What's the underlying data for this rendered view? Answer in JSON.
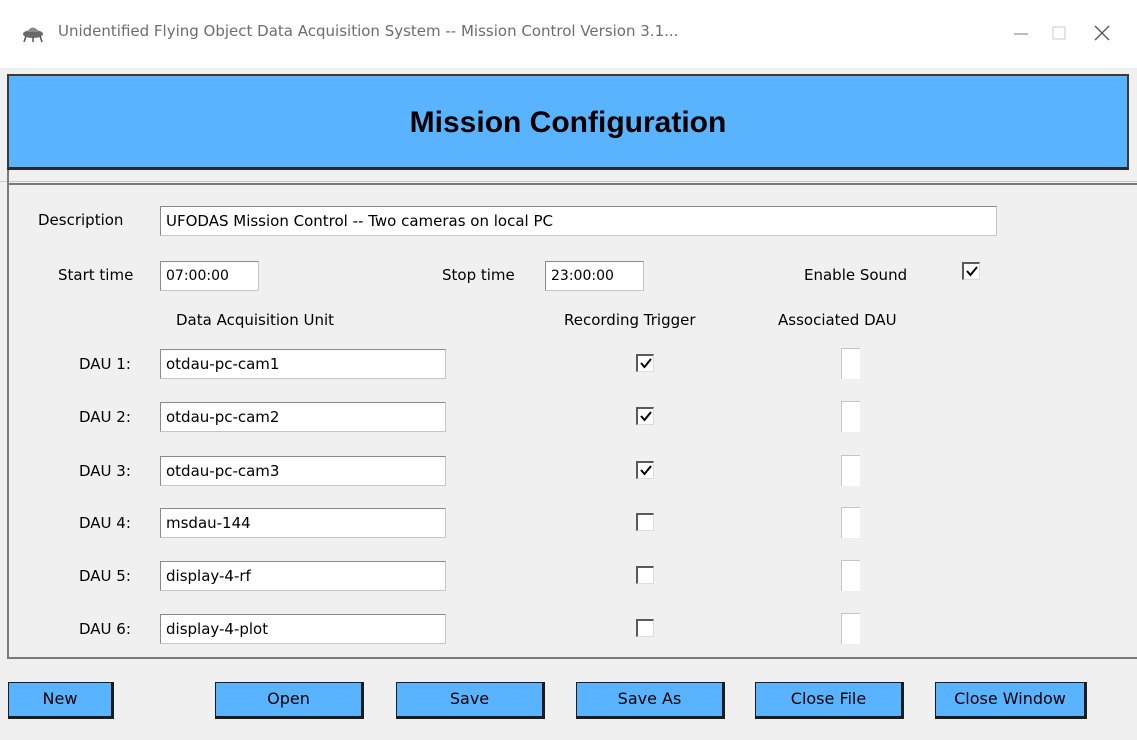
{
  "window": {
    "title": "Unidentified Flying Object Data Acquisition System -- Mission Control   Version 3.1...",
    "minimize_icon": "minimize-icon",
    "maximize_icon": "maximize-icon",
    "close_icon": "close-icon"
  },
  "banner": {
    "title": "Mission Configuration",
    "color": "#5ab3ff"
  },
  "form": {
    "description_label": "Description",
    "description_value": "UFODAS Mission Control -- Two cameras on local PC",
    "start_time_label": "Start time",
    "start_time_value": "07:00:00",
    "stop_time_label": "Stop time",
    "stop_time_value": "23:00:00",
    "enable_sound_label": "Enable Sound",
    "enable_sound_checked": true
  },
  "columns": {
    "dau": "Data Acquisition Unit",
    "trigger": "Recording Trigger",
    "associated": "Associated DAU"
  },
  "daus": [
    {
      "label": "DAU 1:",
      "value": "otdau-pc-cam1",
      "trigger": true,
      "associated": false
    },
    {
      "label": "DAU 2:",
      "value": "otdau-pc-cam2",
      "trigger": true,
      "associated": false
    },
    {
      "label": "DAU 3:",
      "value": "otdau-pc-cam3",
      "trigger": true,
      "associated": false
    },
    {
      "label": "DAU 4:",
      "value": "msdau-144",
      "trigger": false,
      "associated": false
    },
    {
      "label": "DAU 5:",
      "value": "display-4-rf",
      "trigger": false,
      "associated": false
    },
    {
      "label": "DAU 6:",
      "value": "display-4-plot",
      "trigger": false,
      "associated": false
    }
  ],
  "buttons": {
    "new": "New",
    "open": "Open",
    "save": "Save",
    "save_as": "Save As",
    "close_file": "Close File",
    "close_window": "Close Window"
  }
}
